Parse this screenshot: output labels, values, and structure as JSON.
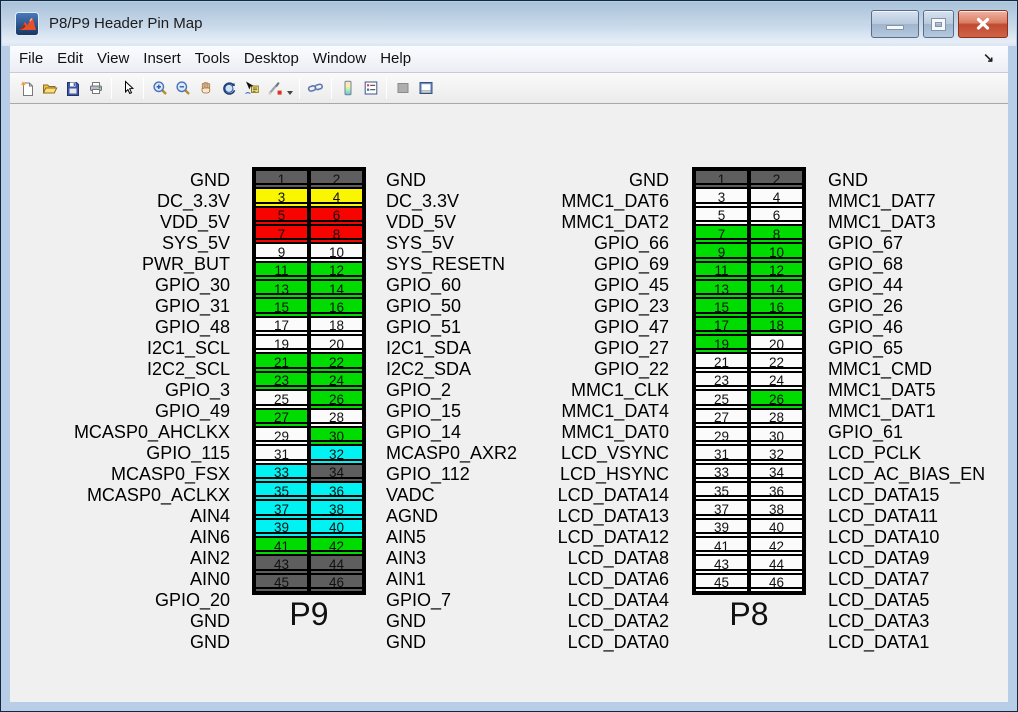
{
  "window": {
    "title": "P8/P9 Header Pin Map",
    "buttons": [
      "minimize",
      "maximize",
      "close"
    ]
  },
  "menu": {
    "items": [
      "File",
      "Edit",
      "View",
      "Insert",
      "Tools",
      "Desktop",
      "Window",
      "Help"
    ],
    "overflow_arrow": "↘"
  },
  "toolbar": {
    "icons": [
      "new-figure",
      "open-file",
      "save-figure",
      "print-figure",
      "edit-plot",
      "zoom-in",
      "zoom-out",
      "pan",
      "rotate-3d",
      "data-cursor",
      "brush",
      "brush-dropdown",
      "link-plot",
      "insert-colorbar",
      "insert-legend",
      "hide-plot-tools",
      "show-plot-tools"
    ]
  },
  "palette": {
    "gray": "#5e5e5e",
    "yellow": "#f9f600",
    "red": "#f80400",
    "white": "#fbfbfb",
    "green": "#00dc00",
    "cyan": "#00f2f2"
  },
  "headers": {
    "p9": {
      "label": "P9",
      "rows": [
        {
          "left_label": "GND",
          "left_pin": 1,
          "left_color": "gray",
          "right_pin": 2,
          "right_color": "gray",
          "right_label": "GND"
        },
        {
          "left_label": "DC_3.3V",
          "left_pin": 3,
          "left_color": "yellow",
          "right_pin": 4,
          "right_color": "yellow",
          "right_label": "DC_3.3V"
        },
        {
          "left_label": "VDD_5V",
          "left_pin": 5,
          "left_color": "red",
          "right_pin": 6,
          "right_color": "red",
          "right_label": "VDD_5V"
        },
        {
          "left_label": "SYS_5V",
          "left_pin": 7,
          "left_color": "red",
          "right_pin": 8,
          "right_color": "red",
          "right_label": "SYS_5V"
        },
        {
          "left_label": "PWR_BUT",
          "left_pin": 9,
          "left_color": "white",
          "right_pin": 10,
          "right_color": "white",
          "right_label": "SYS_RESETN"
        },
        {
          "left_label": "GPIO_30",
          "left_pin": 11,
          "left_color": "green",
          "right_pin": 12,
          "right_color": "green",
          "right_label": "GPIO_60"
        },
        {
          "left_label": "GPIO_31",
          "left_pin": 13,
          "left_color": "green",
          "right_pin": 14,
          "right_color": "green",
          "right_label": "GPIO_50"
        },
        {
          "left_label": "GPIO_48",
          "left_pin": 15,
          "left_color": "green",
          "right_pin": 16,
          "right_color": "green",
          "right_label": "GPIO_51"
        },
        {
          "left_label": "I2C1_SCL",
          "left_pin": 17,
          "left_color": "white",
          "right_pin": 18,
          "right_color": "white",
          "right_label": "I2C1_SDA"
        },
        {
          "left_label": "I2C2_SCL",
          "left_pin": 19,
          "left_color": "white",
          "right_pin": 20,
          "right_color": "white",
          "right_label": "I2C2_SDA"
        },
        {
          "left_label": "GPIO_3",
          "left_pin": 21,
          "left_color": "green",
          "right_pin": 22,
          "right_color": "green",
          "right_label": "GPIO_2"
        },
        {
          "left_label": "GPIO_49",
          "left_pin": 23,
          "left_color": "green",
          "right_pin": 24,
          "right_color": "green",
          "right_label": "GPIO_15"
        },
        {
          "left_label": "MCASP0_AHCLKX",
          "left_pin": 25,
          "left_color": "white",
          "right_pin": 26,
          "right_color": "green",
          "right_label": "GPIO_14"
        },
        {
          "left_label": "GPIO_115",
          "left_pin": 27,
          "left_color": "green",
          "right_pin": 28,
          "right_color": "white",
          "right_label": "MCASP0_AXR2"
        },
        {
          "left_label": "MCASP0_FSX",
          "left_pin": 29,
          "left_color": "white",
          "right_pin": 30,
          "right_color": "green",
          "right_label": "GPIO_112"
        },
        {
          "left_label": "MCASP0_ACLKX",
          "left_pin": 31,
          "left_color": "white",
          "right_pin": 32,
          "right_color": "cyan",
          "right_label": "VADC"
        },
        {
          "left_label": "AIN4",
          "left_pin": 33,
          "left_color": "cyan",
          "right_pin": 34,
          "right_color": "gray",
          "right_label": "AGND"
        },
        {
          "left_label": "AIN6",
          "left_pin": 35,
          "left_color": "cyan",
          "right_pin": 36,
          "right_color": "cyan",
          "right_label": "AIN5"
        },
        {
          "left_label": "AIN2",
          "left_pin": 37,
          "left_color": "cyan",
          "right_pin": 38,
          "right_color": "cyan",
          "right_label": "AIN3"
        },
        {
          "left_label": "AIN0",
          "left_pin": 39,
          "left_color": "cyan",
          "right_pin": 40,
          "right_color": "cyan",
          "right_label": "AIN1"
        },
        {
          "left_label": "GPIO_20",
          "left_pin": 41,
          "left_color": "green",
          "right_pin": 42,
          "right_color": "green",
          "right_label": "GPIO_7"
        },
        {
          "left_label": "GND",
          "left_pin": 43,
          "left_color": "gray",
          "right_pin": 44,
          "right_color": "gray",
          "right_label": "GND"
        },
        {
          "left_label": "GND",
          "left_pin": 45,
          "left_color": "gray",
          "right_pin": 46,
          "right_color": "gray",
          "right_label": "GND"
        }
      ]
    },
    "p8": {
      "label": "P8",
      "rows": [
        {
          "left_label": "GND",
          "left_pin": 1,
          "left_color": "gray",
          "right_pin": 2,
          "right_color": "gray",
          "right_label": "GND"
        },
        {
          "left_label": "MMC1_DAT6",
          "left_pin": 3,
          "left_color": "white",
          "right_pin": 4,
          "right_color": "white",
          "right_label": "MMC1_DAT7"
        },
        {
          "left_label": "MMC1_DAT2",
          "left_pin": 5,
          "left_color": "white",
          "right_pin": 6,
          "right_color": "white",
          "right_label": "MMC1_DAT3"
        },
        {
          "left_label": "GPIO_66",
          "left_pin": 7,
          "left_color": "green",
          "right_pin": 8,
          "right_color": "green",
          "right_label": "GPIO_67"
        },
        {
          "left_label": "GPIO_69",
          "left_pin": 9,
          "left_color": "green",
          "right_pin": 10,
          "right_color": "green",
          "right_label": "GPIO_68"
        },
        {
          "left_label": "GPIO_45",
          "left_pin": 11,
          "left_color": "green",
          "right_pin": 12,
          "right_color": "green",
          "right_label": "GPIO_44"
        },
        {
          "left_label": "GPIO_23",
          "left_pin": 13,
          "left_color": "green",
          "right_pin": 14,
          "right_color": "green",
          "right_label": "GPIO_26"
        },
        {
          "left_label": "GPIO_47",
          "left_pin": 15,
          "left_color": "green",
          "right_pin": 16,
          "right_color": "green",
          "right_label": "GPIO_46"
        },
        {
          "left_label": "GPIO_27",
          "left_pin": 17,
          "left_color": "green",
          "right_pin": 18,
          "right_color": "green",
          "right_label": "GPIO_65"
        },
        {
          "left_label": "GPIO_22",
          "left_pin": 19,
          "left_color": "green",
          "right_pin": 20,
          "right_color": "white",
          "right_label": "MMC1_CMD"
        },
        {
          "left_label": "MMC1_CLK",
          "left_pin": 21,
          "left_color": "white",
          "right_pin": 22,
          "right_color": "white",
          "right_label": "MMC1_DAT5"
        },
        {
          "left_label": "MMC1_DAT4",
          "left_pin": 23,
          "left_color": "white",
          "right_pin": 24,
          "right_color": "white",
          "right_label": "MMC1_DAT1"
        },
        {
          "left_label": "MMC1_DAT0",
          "left_pin": 25,
          "left_color": "white",
          "right_pin": 26,
          "right_color": "green",
          "right_label": "GPIO_61"
        },
        {
          "left_label": "LCD_VSYNC",
          "left_pin": 27,
          "left_color": "white",
          "right_pin": 28,
          "right_color": "white",
          "right_label": "LCD_PCLK"
        },
        {
          "left_label": "LCD_HSYNC",
          "left_pin": 29,
          "left_color": "white",
          "right_pin": 30,
          "right_color": "white",
          "right_label": "LCD_AC_BIAS_EN"
        },
        {
          "left_label": "LCD_DATA14",
          "left_pin": 31,
          "left_color": "white",
          "right_pin": 32,
          "right_color": "white",
          "right_label": "LCD_DATA15"
        },
        {
          "left_label": "LCD_DATA13",
          "left_pin": 33,
          "left_color": "white",
          "right_pin": 34,
          "right_color": "white",
          "right_label": "LCD_DATA11"
        },
        {
          "left_label": "LCD_DATA12",
          "left_pin": 35,
          "left_color": "white",
          "right_pin": 36,
          "right_color": "white",
          "right_label": "LCD_DATA10"
        },
        {
          "left_label": "LCD_DATA8",
          "left_pin": 37,
          "left_color": "white",
          "right_pin": 38,
          "right_color": "white",
          "right_label": "LCD_DATA9"
        },
        {
          "left_label": "LCD_DATA6",
          "left_pin": 39,
          "left_color": "white",
          "right_pin": 40,
          "right_color": "white",
          "right_label": "LCD_DATA7"
        },
        {
          "left_label": "LCD_DATA4",
          "left_pin": 41,
          "left_color": "white",
          "right_pin": 42,
          "right_color": "white",
          "right_label": "LCD_DATA5"
        },
        {
          "left_label": "LCD_DATA2",
          "left_pin": 43,
          "left_color": "white",
          "right_pin": 44,
          "right_color": "white",
          "right_label": "LCD_DATA3"
        },
        {
          "left_label": "LCD_DATA0",
          "left_pin": 45,
          "left_color": "white",
          "right_pin": 46,
          "right_color": "white",
          "right_label": "LCD_DATA1"
        }
      ]
    }
  }
}
